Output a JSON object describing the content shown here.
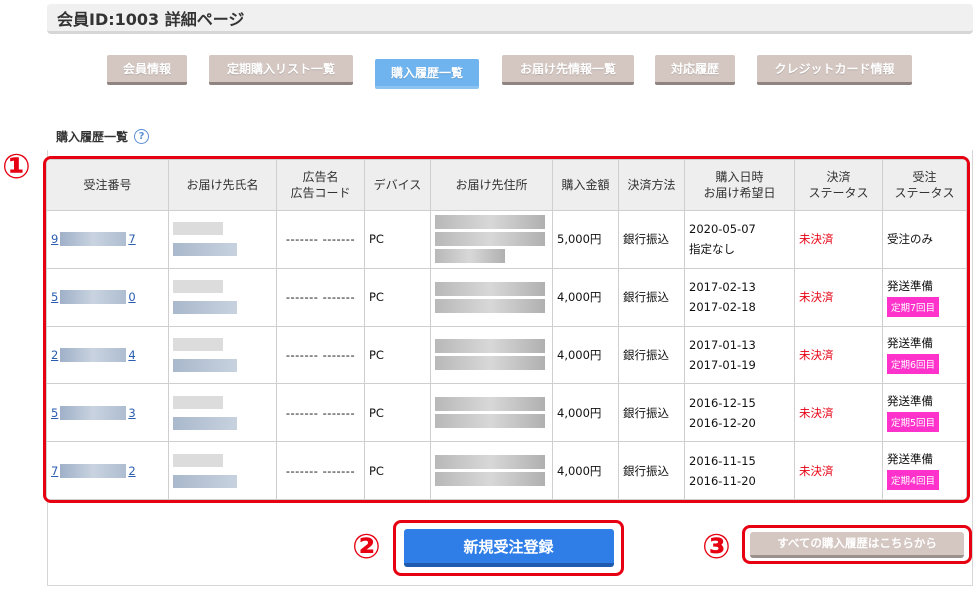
{
  "page_title": "会員ID:1003 詳細ページ",
  "tabs": [
    {
      "label": "会員情報",
      "active": false
    },
    {
      "label": "定期購入リスト一覧",
      "active": false
    },
    {
      "label": "購入履歴一覧",
      "active": true
    },
    {
      "label": "お届け先情報一覧",
      "active": false
    },
    {
      "label": "対応履歴",
      "active": false
    },
    {
      "label": "クレジットカード情報",
      "active": false
    }
  ],
  "section": {
    "title": "購入履歴一覧",
    "help_icon": "question-circle-icon"
  },
  "markers": {
    "one": "①",
    "two": "②",
    "three": "③"
  },
  "table": {
    "headers": {
      "order_no": "受注番号",
      "name": "お届け先氏名",
      "ad_line1": "広告名",
      "ad_line2": "広告コード",
      "device": "デバイス",
      "address": "お届け先住所",
      "amount": "購入金額",
      "payment": "決済方法",
      "date_line1": "購入日時",
      "date_line2": "お届け希望日",
      "settle_line1": "決済",
      "settle_line2": "ステータス",
      "order_line1": "受注",
      "order_line2": "ステータス"
    },
    "rows": [
      {
        "order_prefix": "9",
        "order_suffix": "7",
        "ad": "------- -------",
        "device": "PC",
        "amount": "5,000円",
        "payment": "銀行振込",
        "date": "2020-05-07",
        "delivery": "指定なし",
        "settle": "未決済",
        "status": "受注のみ",
        "badge": ""
      },
      {
        "order_prefix": "5",
        "order_suffix": "0",
        "ad": "------- -------",
        "device": "PC",
        "amount": "4,000円",
        "payment": "銀行振込",
        "date": "2017-02-13",
        "delivery": "2017-02-18",
        "settle": "未決済",
        "status": "発送準備",
        "badge": "定期7回目"
      },
      {
        "order_prefix": "2",
        "order_suffix": "4",
        "ad": "------- -------",
        "device": "PC",
        "amount": "4,000円",
        "payment": "銀行振込",
        "date": "2017-01-13",
        "delivery": "2017-01-19",
        "settle": "未決済",
        "status": "発送準備",
        "badge": "定期6回目"
      },
      {
        "order_prefix": "5",
        "order_suffix": "3",
        "ad": "------- -------",
        "device": "PC",
        "amount": "4,000円",
        "payment": "銀行振込",
        "date": "2016-12-15",
        "delivery": "2016-12-20",
        "settle": "未決済",
        "status": "発送準備",
        "badge": "定期5回目"
      },
      {
        "order_prefix": "7",
        "order_suffix": "2",
        "ad": "------- -------",
        "device": "PC",
        "amount": "4,000円",
        "payment": "銀行振込",
        "date": "2016-11-15",
        "delivery": "2016-11-20",
        "settle": "未決済",
        "status": "発送準備",
        "badge": "定期4回目"
      }
    ]
  },
  "buttons": {
    "new_order": "新規受注登録",
    "all_history": "すべての購入履歴はこちらから"
  },
  "colors": {
    "accent_red": "#e60012",
    "primary_blue": "#2f7ee8",
    "tab_active": "#6fb4ee",
    "tab_inactive": "#d4c7c2",
    "badge_pink": "#ff33cc"
  }
}
